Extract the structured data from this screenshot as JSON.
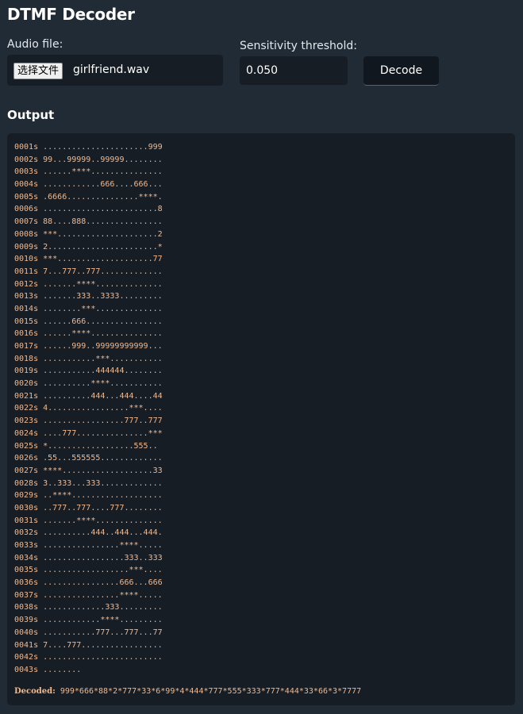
{
  "app": {
    "title": "DTMF Decoder"
  },
  "form": {
    "audio_label": "Audio file:",
    "file_button_label": "选择文件",
    "file_name": "girlfriend.wav",
    "threshold_label": "Sensitivity threshold:",
    "threshold_value": "0.050",
    "decode_label": "Decode"
  },
  "output": {
    "heading": "Output",
    "lines": [
      "0001s ......................999",
      "0002s 99...99999..99999........",
      "0003s ......****...............",
      "0004s ............666....666...",
      "0005s .6666...............****.",
      "0006s ........................8",
      "0007s 88....888................",
      "0008s ***.....................2",
      "0009s 2.......................*",
      "0010s ***....................77",
      "0011s 7...777..777.............",
      "0012s .......****..............",
      "0013s .......333..3333.........",
      "0014s ........***..............",
      "0015s ......666................",
      "0016s ......****...............",
      "0017s ......999..99999999999...",
      "0018s ...........***...........",
      "0019s ...........444444........",
      "0020s ..........****...........",
      "0021s ..........444...444....44",
      "0022s 4.................***....",
      "0023s .................777..777",
      "0024s ....777...............***",
      "0025s *..................555..",
      "0026s .55...555555.............",
      "0027s ****...................33",
      "0028s 3..333...333.............",
      "0029s ..****...................",
      "0030s ..777..777....777........",
      "0031s .......****..............",
      "0032s ..........444..444...444.",
      "0033s ................****.....",
      "0034s .................333..333",
      "0035s ..................***....",
      "0036s ................666...666",
      "0037s ................****.....",
      "0038s .............333.........",
      "0039s ............****.........",
      "0040s ...........777...777...77",
      "0041s 7....777.................",
      "0042s .........................",
      "0043s ........"
    ],
    "decoded_label": "Decoded:",
    "decoded_value": "999*666*88*2*777*33*6*99*4*444*777*555*333*777*444*33*66*3*7777"
  }
}
